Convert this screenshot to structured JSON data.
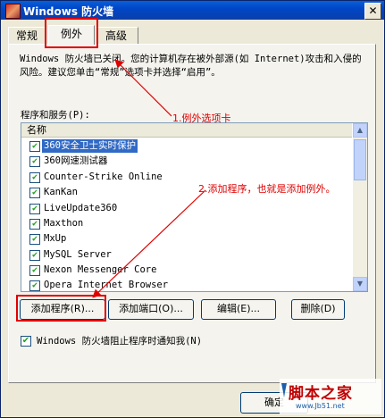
{
  "window": {
    "title": "Windows 防火墙",
    "close_glyph": "✕"
  },
  "tabs": [
    {
      "label": "常规"
    },
    {
      "label": "例外"
    },
    {
      "label": "高级"
    }
  ],
  "description": "Windows 防火墙已关闭。您的计算机存在被外部源(如 Internet)攻击和入侵的风险。建议您单击“常规”选项卡并选择“启用”。",
  "programs": {
    "label": "程序和服务(P):",
    "column_header": "名称",
    "items": [
      {
        "label": "360安全卫士实时保护",
        "checked": true,
        "selected": true
      },
      {
        "label": "360网速测试器",
        "checked": true
      },
      {
        "label": "Counter-Strike Online",
        "checked": true
      },
      {
        "label": "KanKan",
        "checked": true
      },
      {
        "label": "LiveUpdate360",
        "checked": true
      },
      {
        "label": "Maxthon",
        "checked": true
      },
      {
        "label": "MxUp",
        "checked": true
      },
      {
        "label": "MySQL Server",
        "checked": true
      },
      {
        "label": "Nexon Messenger Core",
        "checked": true
      },
      {
        "label": "Opera Internet Browser",
        "checked": true
      }
    ]
  },
  "buttons": {
    "add_program": "添加程序(R)...",
    "add_port": "添加端口(O)...",
    "edit": "编辑(E)...",
    "delete": "删除(D)"
  },
  "notify_checkbox": {
    "label": "Windows 防火墙阻止程序时通知我(N)",
    "checked": true
  },
  "ok_label": "确定",
  "annotations": {
    "tab_note": "1.例外选项卡",
    "add_note": "2.添加程序，也就是添加例外。"
  },
  "watermark": {
    "main": "脚本之家",
    "sub": "www.Jb51.net"
  },
  "colors": {
    "annotation": "#e00000",
    "selection": "#316ac5",
    "titlebar": "#0046c8"
  }
}
